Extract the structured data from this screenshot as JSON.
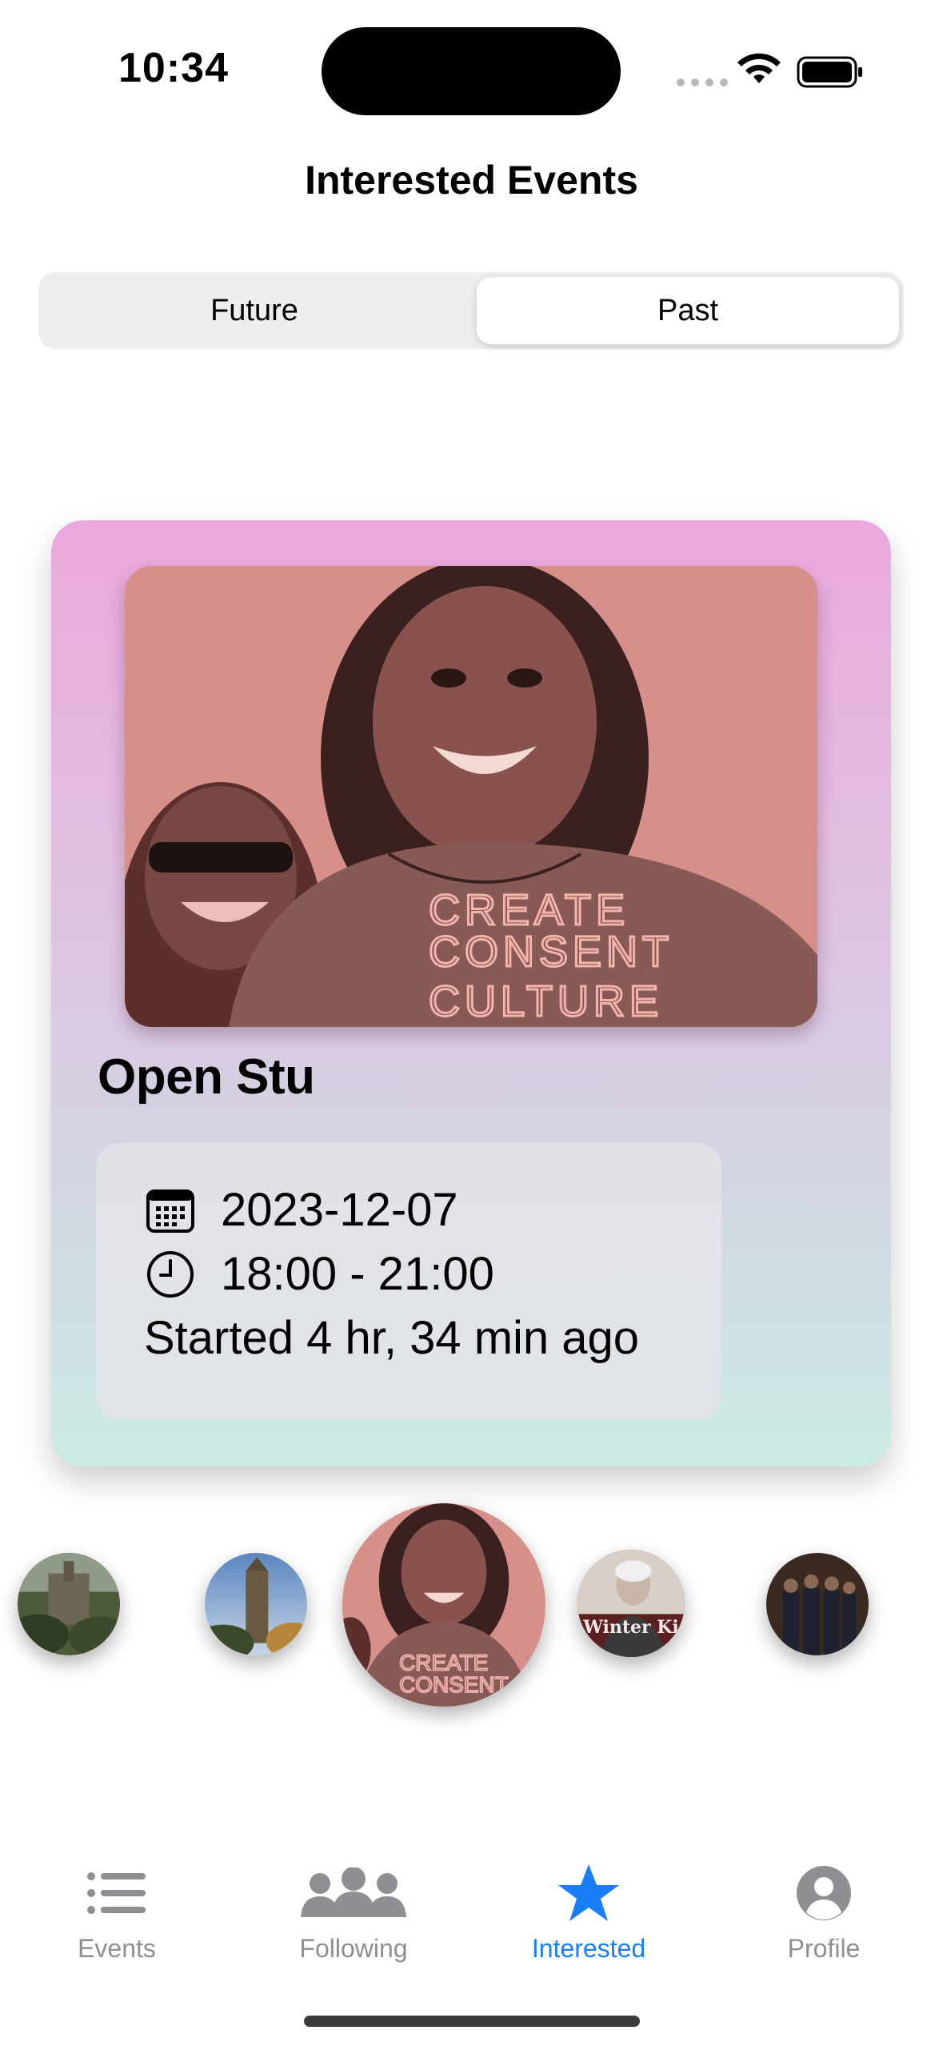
{
  "status_bar": {
    "time": "10:34"
  },
  "header": {
    "title": "Interested Events"
  },
  "segments": {
    "future": "Future",
    "past": "Past",
    "selected": "Past"
  },
  "event": {
    "title": "Open Stu",
    "date": "2023-12-07",
    "time_range": "18:00 - 21:00",
    "relative": "Started 4 hr, 34 min ago",
    "image_text": [
      "CREATE",
      "CONSENT",
      "CULTURE"
    ]
  },
  "carousel": {
    "selected_index": 2,
    "items": [
      {
        "name": "campus-buildings"
      },
      {
        "name": "chapel-tower"
      },
      {
        "name": "open-stu"
      },
      {
        "name": "speaker",
        "caption": "Winter Ki"
      },
      {
        "name": "group-photo"
      }
    ]
  },
  "tabs": [
    {
      "label": "Events",
      "icon": "list-icon"
    },
    {
      "label": "Following",
      "icon": "people-icon"
    },
    {
      "label": "Interested",
      "icon": "star-icon",
      "active": true
    },
    {
      "label": "Profile",
      "icon": "person-circle-icon"
    }
  ],
  "colors": {
    "accent": "#1a7ef8",
    "inactive": "#8e8e93",
    "card_top": "#eba8dc",
    "card_bottom": "#cbebe4",
    "photo_tint": "#d78f89"
  }
}
